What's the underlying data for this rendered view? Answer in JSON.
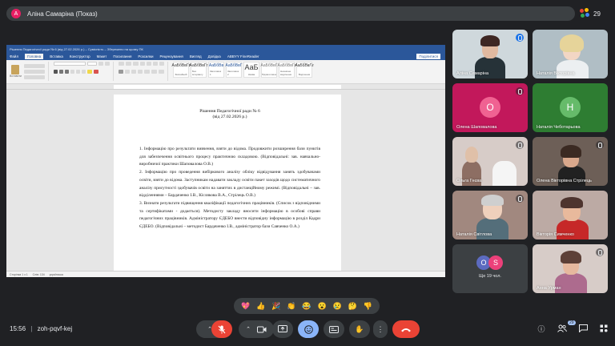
{
  "presenter": {
    "initial": "А",
    "title": "Аліна Самаріна (Показ)"
  },
  "participants_count": "29",
  "word": {
    "titlebar": "Рішення Педагогічної ради № 6 (від 27.02.2026 р.) – Сумісність – Збережено на цьому ПК",
    "tabs": [
      "Файл",
      "Головна",
      "Вставка",
      "Конструктор",
      "Макет",
      "Посилання",
      "Розсилки",
      "Рецензування",
      "Вигляд",
      "Довідка",
      "ABBYY FineReader"
    ],
    "active_tab": "Головна",
    "share_label": "Поділитися",
    "paste_label": "Вставити",
    "styles": [
      {
        "sample": "АаБбВвГг",
        "name": "Звичайний"
      },
      {
        "sample": "АаБбВвГг",
        "name": "Без інтервалу"
      },
      {
        "sample": "АаБбВв",
        "name": "Заголовок 1"
      },
      {
        "sample": "АаБбВвГ",
        "name": "Заголовок 2"
      },
      {
        "sample": "АаБ",
        "name": "Назва"
      },
      {
        "sample": "АаБбВвГ",
        "name": "Підзаголовок"
      },
      {
        "sample": "АаБбВвГг",
        "name": "Незначне виділення"
      },
      {
        "sample": "АаБбВвГг",
        "name": "Виділення"
      }
    ],
    "status": [
      "Сторінка 1 з 1",
      "Слів: 134",
      "українська"
    ],
    "doc": {
      "title_line1": "Рішення Педагогічної ради № 6",
      "title_line2": "(від 27.02.2026 р.)",
      "paragraphs": [
        "1. Інформацію про результати вивчення, взяти до відома. Продовжити розширення бази пунктів для забезпечення освітнього процесу практичною складовою. (Відповідальні: зав. навчально-виробничої практики Шаповалова О.В.)",
        "2. Інформацію про проведення вибіркового аналізу обліку відвідування занять здобувачами освіти, взяти до відома. Заступникам надавати закладу освіти пакет заходів щодо систематичного аналізу присутності здобувачів освіти на заняттях в дистанційному режимі. (Відповідальні – зав. відділеннями – Бардаченко І.В., Кіслякова В.А., Стрілець О.В.)",
        "3. Визнати результати підвищення кваліфікації педагогічних працівників. (Список з відповідними та сертифікатами - додається). Методисту закладу вносити інформацію в особові справи педагогічних працівників. Адміністратору ЄДЕБО внести відповідну інформацію в розділ Кадри ЄДЕБО. (Відповідальні – методист Бардаченко І.В., адміністратор бази Савченко О.А.)"
      ]
    }
  },
  "tiles": [
    {
      "name": "Аліна Самаріна",
      "kind": "video",
      "active_speaker": true
    },
    {
      "name": "Наталія Вікторівна",
      "kind": "video"
    },
    {
      "name": "Олена Шаповалова",
      "kind": "initial",
      "initial": "О",
      "color": "#e0408a",
      "bg": "#d65a8c"
    },
    {
      "name": "Наталія Чеботарьова",
      "kind": "initial",
      "initial": "Н",
      "color": "#43a047",
      "bg": "#3d7a3d"
    },
    {
      "name": "Ольга Гнєва",
      "kind": "video"
    },
    {
      "name": "Олена Вікторівна Стрілець",
      "kind": "video"
    },
    {
      "name": "Наталія Світлова",
      "kind": "video"
    },
    {
      "name": "Вікторія Симченко",
      "kind": "video"
    },
    {
      "name": "Ще 19 чол.",
      "kind": "more",
      "avatars": [
        {
          "initial": "O",
          "color": "#5c6bc0"
        },
        {
          "initial": "S",
          "color": "#ec407a"
        }
      ]
    },
    {
      "name": "Анна Урман",
      "kind": "video"
    }
  ],
  "reactions": [
    "💖",
    "👍",
    "🎉",
    "👏",
    "😂",
    "😮",
    "😢",
    "🤔",
    "👎"
  ],
  "bottom": {
    "time": "15:56",
    "separator": "|",
    "meeting_code": "zoh-pqvf-kej"
  },
  "colors": {
    "meet_bg": "#202124",
    "control_bg": "#3c4043",
    "end_call": "#ea4335",
    "active_control": "#8ab4f8",
    "word_blue": "#2b579a"
  }
}
